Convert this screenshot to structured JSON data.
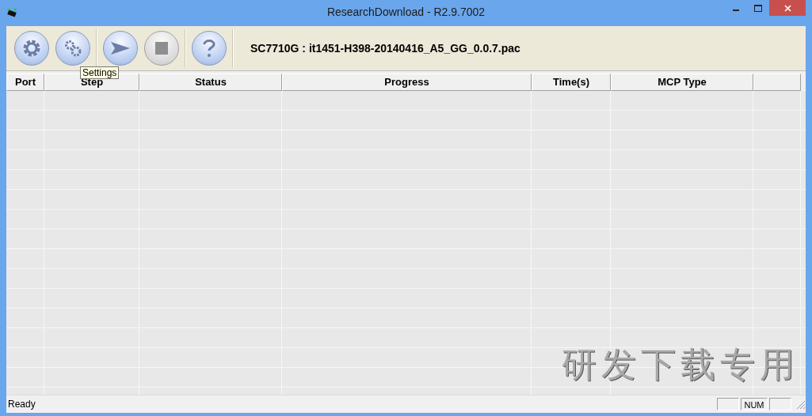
{
  "window": {
    "title": "ResearchDownload - R2.9.7002"
  },
  "toolbar": {
    "buttons": [
      {
        "kind": "gear",
        "disabled": false
      },
      {
        "kind": "gears",
        "disabled": false
      },
      {
        "kind": "play",
        "disabled": false
      },
      {
        "kind": "stop",
        "disabled": true
      },
      {
        "kind": "help",
        "disabled": false
      }
    ],
    "file_label": "SC7710G : it1451-H398-20140416_A5_GG_0.0.7.pac"
  },
  "tooltip": "Settings",
  "table": {
    "columns": [
      "Port",
      "Step",
      "Status",
      "Progress",
      "Time(s)",
      "MCP Type",
      ""
    ]
  },
  "background_text": "研发下载专用",
  "status_bar": {
    "text": "Ready",
    "indicators": [
      {
        "kind": "blank"
      },
      {
        "kind": "text",
        "text": "NUM"
      },
      {
        "kind": "blank"
      }
    ]
  }
}
